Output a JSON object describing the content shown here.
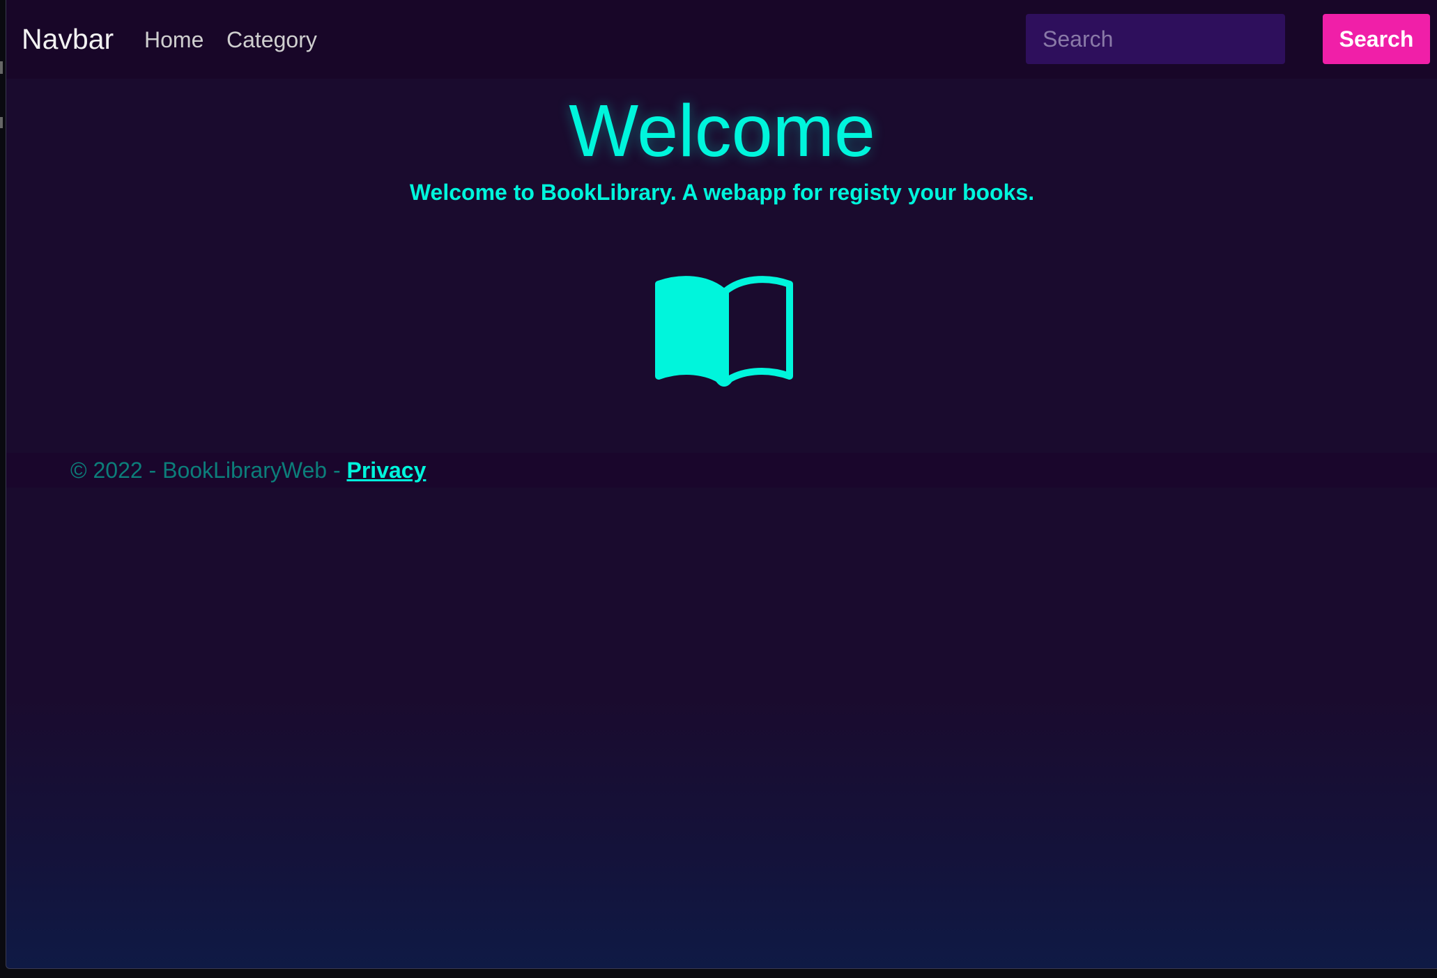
{
  "navbar": {
    "brand": "Navbar",
    "links": [
      {
        "label": "Home"
      },
      {
        "label": "Category"
      }
    ],
    "search": {
      "placeholder": "Search",
      "value": "",
      "button_label": "Search"
    }
  },
  "main": {
    "title": "Welcome",
    "subtitle": "Welcome to BookLibrary. A webapp for registy your books.",
    "icon": "open-book-icon"
  },
  "footer": {
    "copyright": "© 2022 - BookLibraryWeb - ",
    "privacy_label": "Privacy"
  },
  "colors": {
    "background": "#1a0b2e",
    "navbar": "#180628",
    "accent_cyan": "#00f5dc",
    "accent_pink": "#f01fa8",
    "search_field": "#2e0f5c",
    "footer_text": "#0c7e7a"
  }
}
